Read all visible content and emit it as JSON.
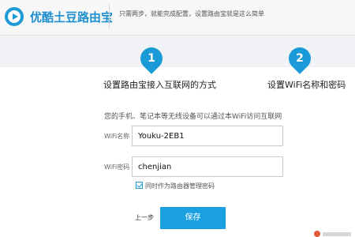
{
  "header": {
    "app_title": "优酷土豆路由宝",
    "note": "只需两步，就能完成配置，设置路由宝就是这么简单"
  },
  "steps": [
    {
      "number": "1",
      "label": "设置路由宝接入互联网的方式"
    },
    {
      "number": "2",
      "label": "设置WiFi名称和密码"
    }
  ],
  "form": {
    "description": "您的手机、笔记本等无线设备可以通过本WiFi访问互联网",
    "wifi_name_label": "WiFi名称",
    "wifi_name_value": "Youku-2EB1",
    "wifi_password_label": "WiFi密码",
    "wifi_password_value": "chenjian",
    "checkbox_label": "同时作为路由器管理密码",
    "checkbox_checked": true
  },
  "actions": {
    "prev_label": "上一步",
    "save_label": "保存"
  },
  "colors": {
    "accent": "#1ba1e2",
    "title": "#1e8fcf"
  }
}
